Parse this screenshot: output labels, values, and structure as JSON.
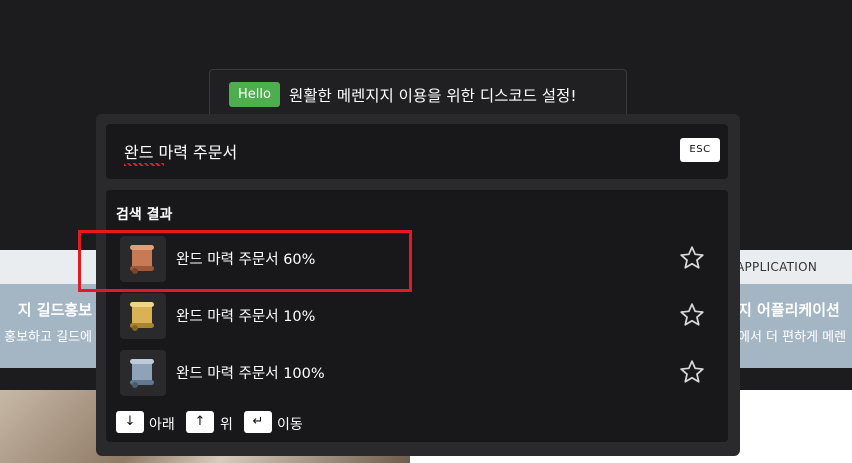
{
  "banner": {
    "badge": "Hello",
    "text": "원활한 메렌지지 이용을 위한 디스코드 설정!"
  },
  "search": {
    "value": "완드 마력 주문서",
    "esc_label": "ESC"
  },
  "results": {
    "title": "검색 결과",
    "items": [
      {
        "label": "완드 마력 주문서 60%",
        "icon": "scroll-red-icon",
        "color": "#c77a54"
      },
      {
        "label": "완드 마력 주문서 10%",
        "icon": "scroll-yellow-icon",
        "color": "#d8b254"
      },
      {
        "label": "완드 마력 주문서 100%",
        "icon": "scroll-blue-icon",
        "color": "#8ea3b8"
      }
    ]
  },
  "footer": {
    "down_key": "↓",
    "down_label": "아래",
    "up_key": "↑",
    "up_label": "위",
    "enter_key": "↵",
    "enter_label": "이동"
  },
  "background": {
    "left_heading": "지 길드홍보",
    "left_text": "홍보하고 길드에",
    "right_tag": "APPLICATION",
    "right_heading": "지 어플리케이션",
    "right_text": "에서 더 편하게 메렌"
  },
  "colors": {
    "accent_green": "#4cae4c",
    "highlight_red": "#e01b24"
  }
}
